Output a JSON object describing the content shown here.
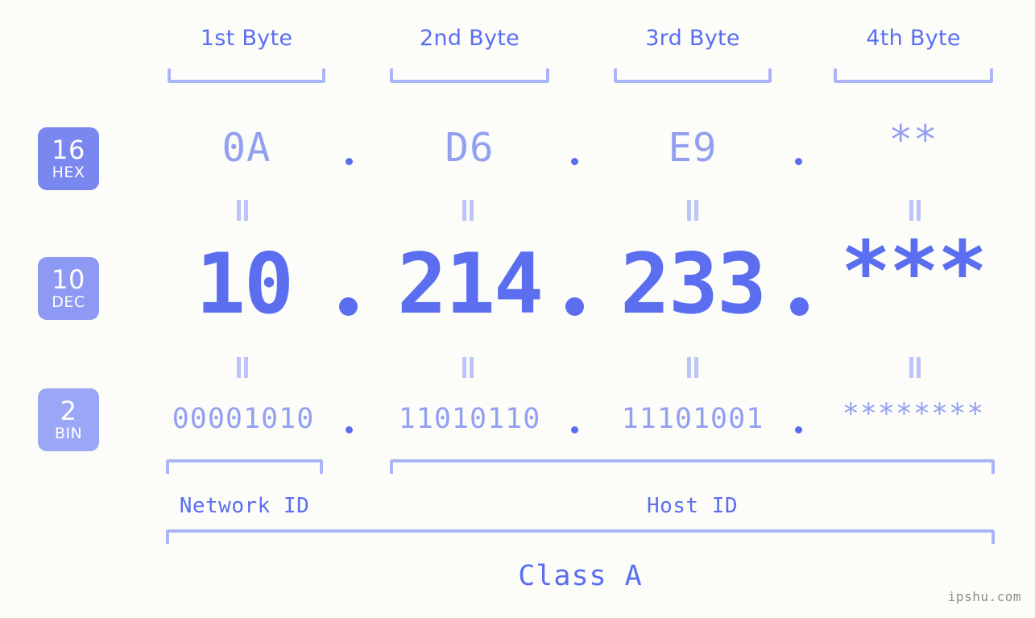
{
  "page": {
    "background": "#fcfdf9",
    "accent": "#5b6ef0",
    "accent_light": "#93a0f2",
    "bracket_color": "#aab4f7",
    "watermark": "ipshu.com"
  },
  "byte_headers": [
    {
      "label": "1st Byte"
    },
    {
      "label": "2nd Byte"
    },
    {
      "label": "3rd Byte"
    },
    {
      "label": "4th Byte"
    }
  ],
  "bases": [
    {
      "num": "16",
      "name": "HEX",
      "color": "#7a87ee"
    },
    {
      "num": "10",
      "name": "DEC",
      "color": "#8d99f2"
    },
    {
      "num": "2",
      "name": "BIN",
      "color": "#9aa7f6"
    }
  ],
  "rows": {
    "hex": {
      "base_num": "16",
      "base_name": "HEX",
      "values": [
        "0A",
        "D6",
        "E9",
        "**"
      ],
      "separator": "."
    },
    "dec": {
      "base_num": "10",
      "base_name": "DEC",
      "values": [
        "10",
        "214",
        "233",
        "***"
      ],
      "separator": "."
    },
    "bin": {
      "base_num": "2",
      "base_name": "BIN",
      "values": [
        "00001010",
        "11010110",
        "11101001",
        "********"
      ],
      "separator": "."
    }
  },
  "equals_marks": {
    "symbol": "=",
    "count_per_row": 4
  },
  "segments": {
    "network_id": "Network ID",
    "host_id": "Host ID",
    "class": "Class A"
  }
}
